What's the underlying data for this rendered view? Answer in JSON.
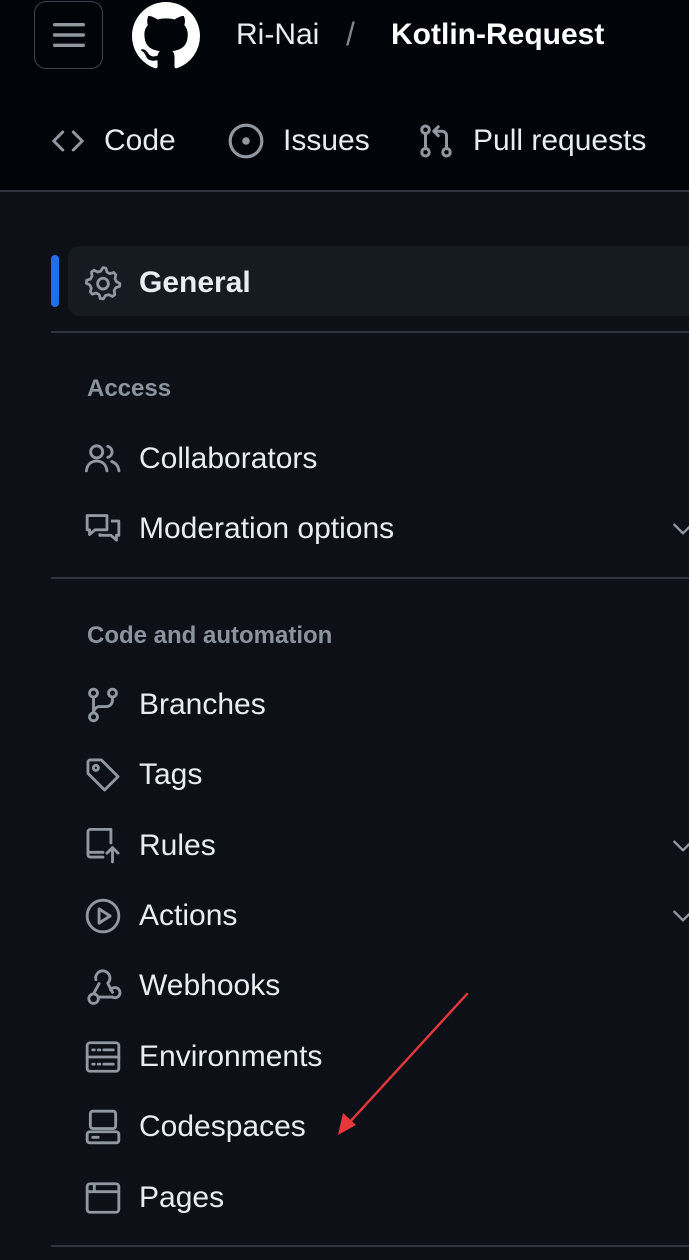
{
  "header": {
    "owner": "Ri-Nai",
    "separator": "/",
    "repo": "Kotlin-Request",
    "tabs": [
      {
        "label": "Code",
        "icon": "code-icon"
      },
      {
        "label": "Issues",
        "icon": "issue-opened-icon"
      },
      {
        "label": "Pull requests",
        "icon": "git-pull-request-icon"
      }
    ]
  },
  "sidebar": {
    "general": {
      "label": "General",
      "icon": "gear-icon",
      "active": true
    },
    "access": {
      "heading": "Access",
      "items": [
        {
          "label": "Collaborators",
          "icon": "people-icon"
        },
        {
          "label": "Moderation options",
          "icon": "comment-discussion-icon",
          "expandable": true
        }
      ]
    },
    "code_automation": {
      "heading": "Code and automation",
      "items": [
        {
          "label": "Branches",
          "icon": "git-branch-icon"
        },
        {
          "label": "Tags",
          "icon": "tag-icon"
        },
        {
          "label": "Rules",
          "icon": "repo-push-icon",
          "expandable": true
        },
        {
          "label": "Actions",
          "icon": "play-icon",
          "expandable": true
        },
        {
          "label": "Webhooks",
          "icon": "webhook-icon"
        },
        {
          "label": "Environments",
          "icon": "server-icon"
        },
        {
          "label": "Codespaces",
          "icon": "codespaces-icon"
        },
        {
          "label": "Pages",
          "icon": "browser-icon"
        }
      ]
    }
  },
  "colors": {
    "background": "#0d1117",
    "header_background": "#010409",
    "accent": "#1f6feb",
    "annotation_arrow": "#e5383b"
  }
}
